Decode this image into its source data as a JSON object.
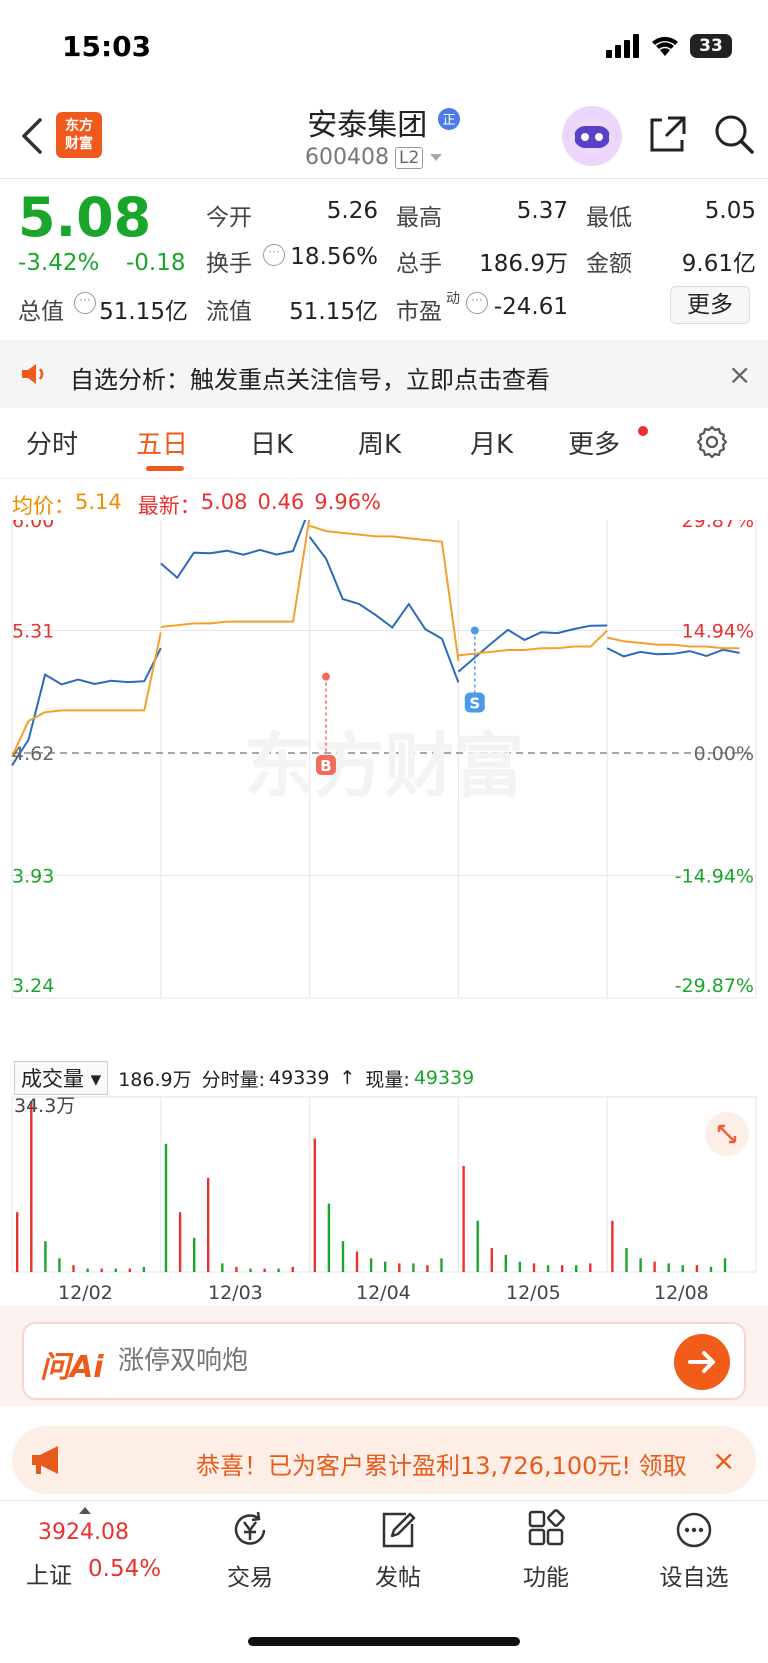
{
  "status_bar": {
    "time": "15:03",
    "battery": "33"
  },
  "header": {
    "logo_line1": "东方",
    "logo_line2": "财富",
    "stock_name": "安泰集团",
    "stock_code": "600408",
    "level_badge": "L2",
    "badge_icon": "zheng-badge-icon"
  },
  "quote": {
    "price": "5.08",
    "change_pct": "-3.42%",
    "change_abs": "-0.18",
    "open_label": "今开",
    "open_value": "5.26",
    "high_label": "最高",
    "high_value": "5.37",
    "low_label": "最低",
    "low_value": "5.05",
    "turnover_label": "换手",
    "turnover_value": "18.56%",
    "volume_label": "总手",
    "volume_value": "186.9万",
    "amount_label": "金额",
    "amount_value": "9.61亿",
    "mktcap_label": "总值",
    "mktcap_value": "51.15亿",
    "float_label": "流值",
    "float_value": "51.15亿",
    "pe_label": "市盈",
    "pe_sup": "动",
    "pe_value": "-24.61",
    "more_label": "更多",
    "up_color": "#e8322f",
    "down_color": "#1aa62a"
  },
  "notice": {
    "text": "自选分析：触发重点关注信号，立即点击查看",
    "close": "×"
  },
  "tabs": {
    "items": [
      "分时",
      "五日",
      "日K",
      "周K",
      "月K",
      "更多"
    ],
    "active": "五日",
    "accent": "#ef5a1c"
  },
  "legend": {
    "avg_label": "均价：",
    "avg_value": "5.14",
    "latest_label": "最新：",
    "latest_value": "5.08",
    "latest_change": "0.46",
    "latest_pct": "9.96%"
  },
  "chart_data": {
    "type": "line",
    "title": "",
    "days": [
      "12/02",
      "12/03",
      "12/04",
      "12/05",
      "12/08"
    ],
    "y_ticks_left": [
      "6.00",
      "5.31",
      "4.62",
      "3.93",
      "3.24"
    ],
    "y_ticks_right": [
      "29.87%",
      "14.94%",
      "0.00%",
      "-14.94%",
      "-29.87%"
    ],
    "ylim": [
      3.24,
      6.0
    ],
    "base": 4.62,
    "series": [
      {
        "name": "",
        "color": "#2b6cb8",
        "values": [
          4.55,
          4.7,
          5.05,
          5.02,
          5.02,
          5.02,
          5.02,
          5.02,
          5.03,
          5.2,
          5.7,
          5.6,
          5.75,
          5.75,
          5.75,
          5.75,
          5.75,
          5.75,
          5.75,
          6.0,
          5.85,
          5.7,
          5.5,
          5.45,
          5.4,
          5.33,
          5.45,
          5.33,
          5.25,
          5.03,
          5.08,
          5.15,
          5.25,
          5.3,
          5.27,
          5.29,
          5.3,
          5.32,
          5.33,
          5.35,
          5.2,
          5.17,
          5.19,
          5.17,
          5.19,
          5.18,
          5.18,
          5.19,
          5.19
        ]
      },
      {
        "name": "",
        "color": "#f5a02c",
        "values": [
          4.6,
          4.8,
          4.85,
          4.86,
          4.86,
          4.86,
          4.86,
          4.86,
          4.86,
          5.3,
          5.33,
          5.34,
          5.35,
          5.35,
          5.36,
          5.36,
          5.36,
          5.36,
          5.36,
          5.95,
          5.9,
          5.87,
          5.86,
          5.85,
          5.84,
          5.84,
          5.83,
          5.82,
          5.81,
          5.14,
          5.17,
          5.18,
          5.19,
          5.2,
          5.2,
          5.21,
          5.21,
          5.22,
          5.22,
          5.31,
          5.27,
          5.25,
          5.24,
          5.23,
          5.23,
          5.22,
          5.22,
          5.21,
          5.21
        ]
      }
    ],
    "markers": [
      {
        "label": "B",
        "day": "12/04",
        "value": 5.05,
        "color": "#f26b5b"
      },
      {
        "label": "S",
        "day": "12/05",
        "value": 5.31,
        "color": "#4a9ae8"
      }
    ],
    "watermark": "东方财富"
  },
  "volume": {
    "selector": "成交量",
    "total": "186.9万",
    "period_label": "分时量:",
    "period_value": "49339",
    "arrow": "↑",
    "current_label": "现量:",
    "current_value": "49339",
    "max_label": "34.3万",
    "bars": [
      {
        "v": 0.35,
        "c": "r"
      },
      {
        "v": 1.0,
        "c": "r"
      },
      {
        "v": 0.18,
        "c": "g"
      },
      {
        "v": 0.08,
        "c": "g"
      },
      {
        "v": 0.04,
        "c": "r"
      },
      {
        "v": 0.02,
        "c": "g"
      },
      {
        "v": 0.02,
        "c": "r"
      },
      {
        "v": 0.02,
        "c": "g"
      },
      {
        "v": 0.02,
        "c": "r"
      },
      {
        "v": 0.03,
        "c": "g"
      },
      {
        "v": 0.75,
        "c": "g"
      },
      {
        "v": 0.35,
        "c": "r"
      },
      {
        "v": 0.2,
        "c": "g"
      },
      {
        "v": 0.55,
        "c": "r"
      },
      {
        "v": 0.05,
        "c": "g"
      },
      {
        "v": 0.03,
        "c": "r"
      },
      {
        "v": 0.02,
        "c": "g"
      },
      {
        "v": 0.02,
        "c": "r"
      },
      {
        "v": 0.02,
        "c": "g"
      },
      {
        "v": 0.03,
        "c": "r"
      },
      {
        "v": 0.78,
        "c": "r"
      },
      {
        "v": 0.4,
        "c": "g"
      },
      {
        "v": 0.18,
        "c": "g"
      },
      {
        "v": 0.12,
        "c": "r"
      },
      {
        "v": 0.08,
        "c": "g"
      },
      {
        "v": 0.06,
        "c": "g"
      },
      {
        "v": 0.05,
        "c": "r"
      },
      {
        "v": 0.05,
        "c": "g"
      },
      {
        "v": 0.04,
        "c": "r"
      },
      {
        "v": 0.08,
        "c": "g"
      },
      {
        "v": 0.62,
        "c": "r"
      },
      {
        "v": 0.3,
        "c": "g"
      },
      {
        "v": 0.14,
        "c": "r"
      },
      {
        "v": 0.1,
        "c": "g"
      },
      {
        "v": 0.06,
        "c": "g"
      },
      {
        "v": 0.05,
        "c": "r"
      },
      {
        "v": 0.04,
        "c": "g"
      },
      {
        "v": 0.04,
        "c": "r"
      },
      {
        "v": 0.04,
        "c": "g"
      },
      {
        "v": 0.05,
        "c": "r"
      },
      {
        "v": 0.3,
        "c": "r"
      },
      {
        "v": 0.14,
        "c": "g"
      },
      {
        "v": 0.08,
        "c": "g"
      },
      {
        "v": 0.06,
        "c": "r"
      },
      {
        "v": 0.05,
        "c": "g"
      },
      {
        "v": 0.04,
        "c": "g"
      },
      {
        "v": 0.04,
        "c": "r"
      },
      {
        "v": 0.03,
        "c": "g"
      },
      {
        "v": 0.08,
        "c": "g"
      }
    ]
  },
  "ai_bar": {
    "logo": "问Ai",
    "placeholder": "涨停双响炮"
  },
  "promo": {
    "text": "恭喜！已为客户累计盈利13,726,100元! 领取",
    "close": "×"
  },
  "bottom_nav": {
    "index_value": "3924.08",
    "index_name": "上证",
    "index_pct": "0.54%",
    "items": [
      "交易",
      "发帖",
      "功能",
      "设自选"
    ]
  }
}
